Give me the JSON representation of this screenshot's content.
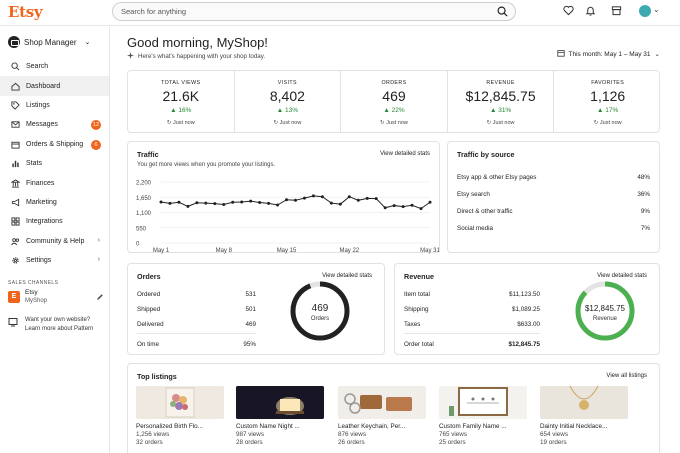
{
  "app": {
    "logo": "Etsy",
    "search_placeholder": "Search for anything"
  },
  "sidebar": {
    "title": "Shop Manager",
    "items": [
      {
        "label": "Search",
        "icon": "search-icon"
      },
      {
        "label": "Dashboard",
        "icon": "home-icon",
        "active": true
      },
      {
        "label": "Listings",
        "icon": "tag-icon"
      },
      {
        "label": "Messages",
        "icon": "mail-icon",
        "badge": "12"
      },
      {
        "label": "Orders & Shipping",
        "icon": "box-icon",
        "badge": "6"
      },
      {
        "label": "Stats",
        "icon": "bar-chart-icon"
      },
      {
        "label": "Finances",
        "icon": "bank-icon"
      },
      {
        "label": "Marketing",
        "icon": "megaphone-icon"
      },
      {
        "label": "Integrations",
        "icon": "grid-icon"
      },
      {
        "label": "Community & Help",
        "icon": "people-icon",
        "arrow": true
      },
      {
        "label": "Settings",
        "icon": "gear-icon",
        "arrow": true
      }
    ],
    "sales_channels_label": "SALES CHANNELS",
    "channel": {
      "badge": "E",
      "name": "Etsy",
      "shop": "MyShop"
    },
    "pattern_text": "Want your own website? Learn more about Pattern"
  },
  "main": {
    "greeting": "Good morning, MyShop!",
    "subtitle": "Here's what's happening with your shop today.",
    "period": "This month: May 1 – May 31",
    "stats": [
      {
        "label": "TOTAL VIEWS",
        "value": "21.6K",
        "change": "16%",
        "note": "Just now"
      },
      {
        "label": "VISITS",
        "value": "8,402",
        "change": "13%",
        "note": "Just now"
      },
      {
        "label": "ORDERS",
        "value": "469",
        "change": "22%",
        "note": "Just now"
      },
      {
        "label": "REVENUE",
        "value": "$12,845.75",
        "change": "31%",
        "note": "Just now"
      },
      {
        "label": "FAVORITES",
        "value": "1,126",
        "change": "17%",
        "note": "Just now"
      }
    ],
    "traffic": {
      "title": "Traffic",
      "subtitle": "You get more views when you promote your listings.",
      "link": "View detailed stats"
    },
    "traffic_source": {
      "title": "Traffic by source",
      "rows": [
        {
          "label": "Etsy app & other Etsy pages",
          "value": "48%"
        },
        {
          "label": "Etsy search",
          "value": "36%"
        },
        {
          "label": "Direct & other traffic",
          "value": "9%"
        },
        {
          "label": "Social media",
          "value": "7%"
        }
      ]
    },
    "orders": {
      "title": "Orders",
      "link": "View detailed stats",
      "rows": [
        {
          "label": "Ordered",
          "value": "531"
        },
        {
          "label": "Shipped",
          "value": "501"
        },
        {
          "label": "Delivered",
          "value": "469"
        }
      ],
      "on_time_label": "On time",
      "on_time_value": "95%",
      "donut_value": "469",
      "donut_label": "Orders",
      "donut_fraction": 0.94
    },
    "revenue": {
      "title": "Revenue",
      "link": "View detailed stats",
      "rows": [
        {
          "label": "Item total",
          "value": "$11,123.50"
        },
        {
          "label": "Shipping",
          "value": "$1,089.25"
        },
        {
          "label": "Taxes",
          "value": "$633.00"
        }
      ],
      "total_label": "Order total",
      "total_value": "$12,845.75",
      "donut_value": "$12,845.75",
      "donut_label": "Revenue",
      "donut_fraction": 0.87,
      "accent": "#4caf50"
    },
    "top_listings": {
      "title": "Top listings",
      "link": "View all listings",
      "items": [
        {
          "name": "Personalized Birth Flo...",
          "views": "1,256 views",
          "orders": "32 orders"
        },
        {
          "name": "Custom Name Night ...",
          "views": "987 views",
          "orders": "28 orders"
        },
        {
          "name": "Leather Keychain, Per...",
          "views": "876 views",
          "orders": "26 orders"
        },
        {
          "name": "Custom Family Name ...",
          "views": "765 views",
          "orders": "25 orders"
        },
        {
          "name": "Dainty Initial Necklace...",
          "views": "654 views",
          "orders": "19 orders"
        }
      ]
    }
  },
  "chart_data": {
    "type": "line",
    "title": "Traffic",
    "x": [
      "May 1",
      "May 2",
      "May 3",
      "May 4",
      "May 5",
      "May 6",
      "May 7",
      "May 8",
      "May 9",
      "May 10",
      "May 11",
      "May 12",
      "May 13",
      "May 14",
      "May 15",
      "May 16",
      "May 17",
      "May 18",
      "May 19",
      "May 20",
      "May 21",
      "May 22",
      "May 23",
      "May 24",
      "May 25",
      "May 26",
      "May 27",
      "May 28",
      "May 29",
      "May 30",
      "May 31"
    ],
    "x_ticks": [
      "May 1",
      "May 8",
      "May 15",
      "May 22",
      "May 31"
    ],
    "y_ticks": [
      "2,200",
      "1,650",
      "1,100",
      "550",
      "0"
    ],
    "series": [
      {
        "values": [
          1480,
          1430,
          1470,
          1320,
          1450,
          1440,
          1420,
          1390,
          1470,
          1480,
          1510,
          1460,
          1430,
          1370,
          1560,
          1540,
          1620,
          1700,
          1670,
          1440,
          1400,
          1670,
          1540,
          1610,
          1600,
          1270,
          1350,
          1310,
          1360,
          1240,
          1470
        ]
      }
    ],
    "ylim": [
      0,
      2200
    ],
    "grid": true,
    "color": "#222222"
  }
}
